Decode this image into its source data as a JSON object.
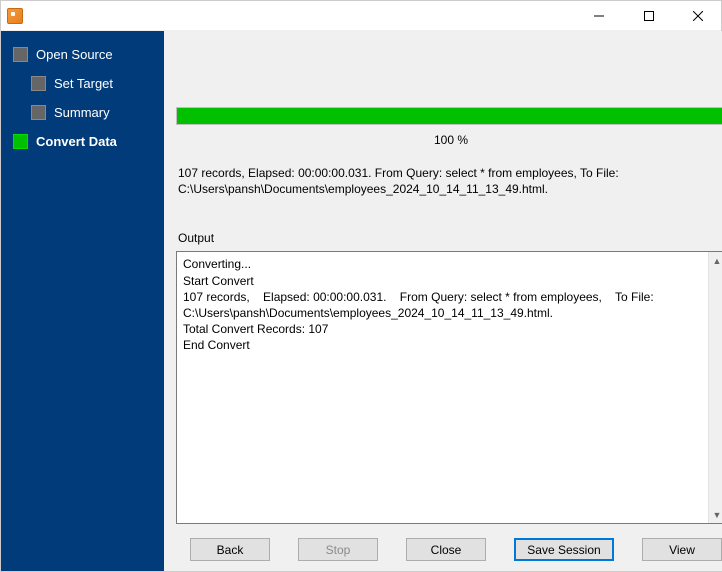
{
  "window": {
    "title": ""
  },
  "sidebar": {
    "items": [
      {
        "label": "Open Source",
        "level": 0,
        "current": false
      },
      {
        "label": "Set Target",
        "level": 1,
        "current": false
      },
      {
        "label": "Summary",
        "level": 1,
        "current": false
      },
      {
        "label": "Convert Data",
        "level": 0,
        "current": true
      }
    ]
  },
  "progress": {
    "percent_label": "100 %",
    "status_text": "107 records,    Elapsed: 00:00:00.031.    From Query: select * from employees,    To File: C:\\Users\\pansh\\Documents\\employees_2024_10_14_11_13_49.html."
  },
  "output": {
    "label": "Output",
    "lines": [
      "Converting...",
      "Start Convert",
      "107 records,    Elapsed: 00:00:00.031.    From Query: select * from employees,    To File: C:\\Users\\pansh\\Documents\\employees_2024_10_14_11_13_49.html.",
      "Total Convert Records: 107",
      "End Convert"
    ]
  },
  "buttons": {
    "back": "Back",
    "stop": "Stop",
    "close": "Close",
    "save_session": "Save Session",
    "view": "View"
  }
}
